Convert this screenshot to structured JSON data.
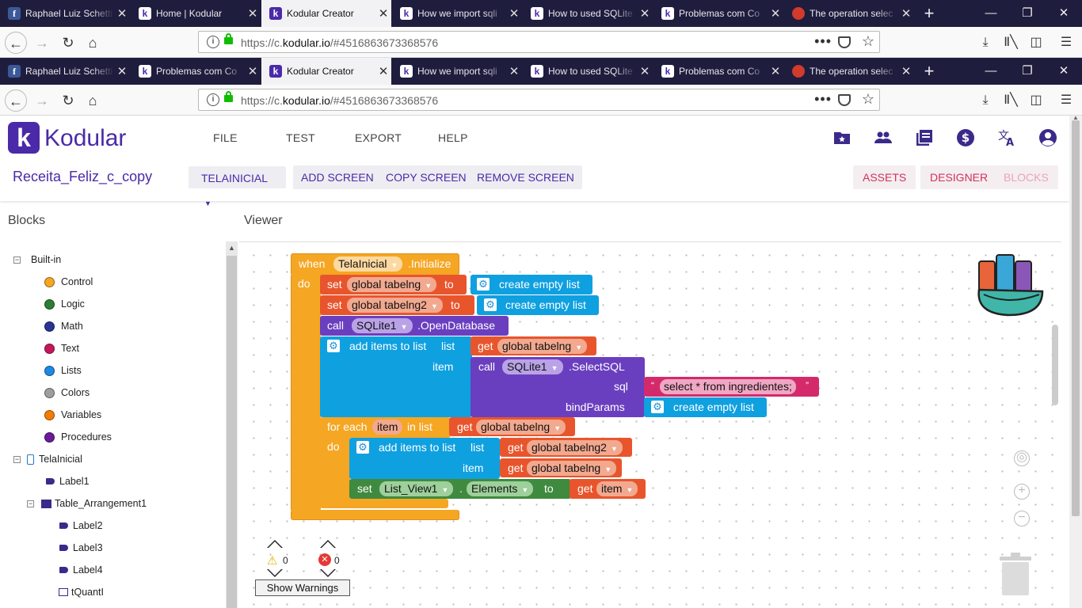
{
  "browser": {
    "tabs": [
      {
        "title": "Raphael Luiz Schetti",
        "favicon": "facebook-icon"
      },
      {
        "title": "Home | Kodular",
        "favicon": "kodular-icon"
      },
      {
        "title": "Kodular Creator",
        "favicon": "kodular-icon",
        "active": true
      },
      {
        "title": "How we import sqli",
        "favicon": "kodular-icon"
      },
      {
        "title": "How to used SQLite",
        "favicon": "kodular-icon"
      },
      {
        "title": "Problemas com Co",
        "favicon": "kodular-icon"
      },
      {
        "title": "The operation selec",
        "favicon": "red-circle-icon"
      }
    ],
    "tabs2": [
      {
        "title": "Raphael Luiz Schetti",
        "favicon": "facebook-icon"
      },
      {
        "title": "Problemas com Co",
        "favicon": "kodular-icon"
      },
      {
        "title": "Kodular Creator",
        "favicon": "kodular-icon",
        "active": true
      },
      {
        "title": "How we import sqli",
        "favicon": "kodular-icon"
      },
      {
        "title": "How to used SQLite",
        "favicon": "kodular-icon"
      },
      {
        "title": "Problemas com Co",
        "favicon": "kodular-icon"
      },
      {
        "title": "The operation selec",
        "favicon": "red-circle-icon"
      }
    ],
    "url_prefix": "https://c.",
    "url_domain": "kodular.io",
    "url_suffix": "/#4516863673368576"
  },
  "app": {
    "logo_letter": "k",
    "logo_text": "Kodular",
    "menu": [
      "FILE",
      "TEST",
      "EXPORT",
      "HELP"
    ],
    "project_name": "Receita_Feliz_c_copy",
    "screen_select": "TELAINICIAL",
    "screen_buttons": [
      "ADD SCREEN",
      "COPY SCREEN",
      "REMOVE SCREEN"
    ],
    "views": {
      "assets": "ASSETS",
      "designer": "DESIGNER",
      "blocks": "BLOCKS"
    },
    "accent": "#4a2aa8"
  },
  "panels": {
    "blocks_title": "Blocks",
    "viewer_title": "Viewer"
  },
  "tree": {
    "builtin_label": "Built-in",
    "builtin": [
      {
        "label": "Control",
        "color": "#f6a623"
      },
      {
        "label": "Logic",
        "color": "#2e7d32"
      },
      {
        "label": "Math",
        "color": "#283593"
      },
      {
        "label": "Text",
        "color": "#c2185b"
      },
      {
        "label": "Lists",
        "color": "#1e88e5"
      },
      {
        "label": "Colors",
        "color": "#9e9e9e"
      },
      {
        "label": "Variables",
        "color": "#f57c00"
      },
      {
        "label": "Procedures",
        "color": "#6a1b9a"
      }
    ],
    "screen_label": "TelaInicial",
    "components": [
      "Label1",
      "Table_Arrangement1",
      "Label2",
      "Label3",
      "Label4",
      "tQuantI"
    ]
  },
  "blocks": {
    "when": "when",
    "event_component": "TelaInicial",
    "event_name": ".Initialize",
    "do": "do",
    "set": "set",
    "to": "to",
    "var1": "global tabelng",
    "var2": "global tabelng2",
    "create_empty_list": "create empty list",
    "call": "call",
    "sqlite": "SQLite1",
    "open_db": ".OpenDatabase",
    "add_items": "add items to list",
    "list": "list",
    "item": "item",
    "get": "get",
    "select_sql": ".SelectSQL",
    "sql": "sql",
    "sql_text": "select * from ingredientes;",
    "bind_params": "bindParams",
    "for_each": "for each",
    "item_var": "item",
    "in_list": "in list",
    "list_view": "List_View1",
    "elements": "Elements",
    "dot": "."
  },
  "warnings": {
    "warn_count": "0",
    "error_count": "0",
    "button": "Show Warnings"
  }
}
